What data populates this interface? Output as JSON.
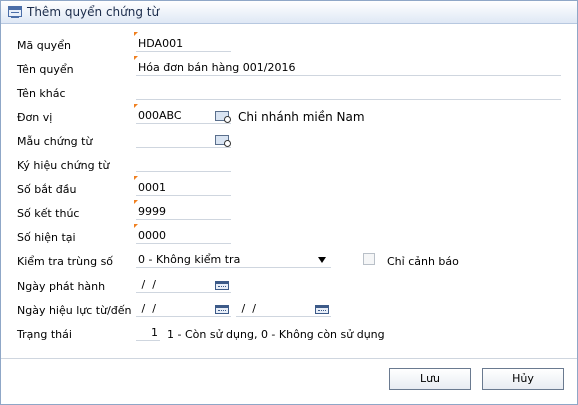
{
  "window": {
    "title": "Thêm quyển chứng từ"
  },
  "labels": {
    "ma_quyen": "Mã quyển",
    "ten_quyen": "Tên quyển",
    "ten_khac": "Tên khác",
    "don_vi": "Đơn vị",
    "mau_chung_tu": "Mẫu chứng từ",
    "ky_hieu": "Ký hiệu chứng từ",
    "so_bat_dau": "Số bắt đầu",
    "so_ket_thuc": "Số kết thúc",
    "so_hien_tai": "Số hiện tại",
    "kiem_tra": "Kiểm tra trùng số",
    "ngay_phat_hanh": "Ngày phát hành",
    "ngay_hieu_luc": "Ngày hiệu lực từ/đến",
    "trang_thai": "Trạng thái"
  },
  "values": {
    "ma_quyen": "HDA001",
    "ten_quyen": "Hóa đơn bán hàng 001/2016",
    "ten_khac": "",
    "don_vi_code": "000ABC",
    "don_vi_name": "Chi nhánh miền Nam",
    "mau_chung_tu": "",
    "ky_hieu": "",
    "so_bat_dau": "0001",
    "so_ket_thuc": "9999",
    "so_hien_tai": "0000",
    "kiem_tra": "0 - Không kiểm tra",
    "ngay_phat_hanh": " /  /",
    "ngay_hieu_luc_tu": " /  /",
    "ngay_hieu_luc_den": " /  /",
    "trang_thai": "1",
    "trang_thai_hint": "1 - Còn sử dụng, 0 - Không còn sử dụng"
  },
  "checkbox": {
    "label": "Chỉ cảnh báo",
    "checked": false
  },
  "buttons": {
    "save": "Lưu",
    "cancel": "Hủy"
  }
}
